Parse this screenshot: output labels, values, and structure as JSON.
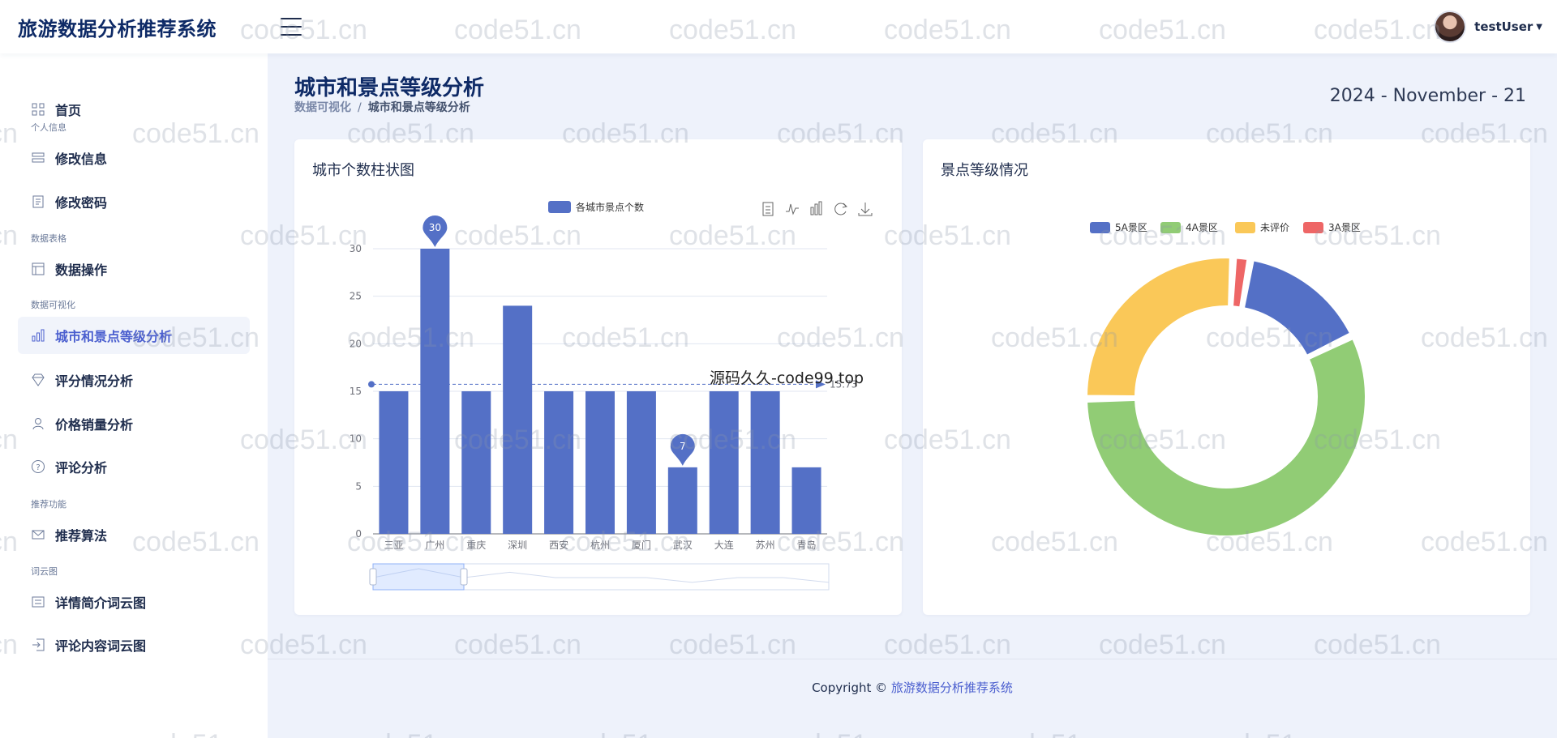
{
  "app": {
    "title": "旅游数据分析推荐系统"
  },
  "user": {
    "name": "testUser"
  },
  "sidebar": {
    "items": [
      {
        "label": "首页",
        "icon": "grid-icon"
      },
      {
        "label": "修改信息",
        "icon": "edit-info-icon"
      },
      {
        "label": "修改密码",
        "icon": "password-icon"
      },
      {
        "label": "数据操作",
        "icon": "table-icon"
      },
      {
        "label": "城市和景点等级分析",
        "icon": "bar-chart-icon",
        "active": true
      },
      {
        "label": "评分情况分析",
        "icon": "diamond-icon"
      },
      {
        "label": "价格销量分析",
        "icon": "user-icon"
      },
      {
        "label": "评论分析",
        "icon": "question-icon"
      },
      {
        "label": "推荐算法",
        "icon": "mail-icon"
      },
      {
        "label": "详情简介词云图",
        "icon": "list-icon"
      },
      {
        "label": "评论内容词云图",
        "icon": "login-icon"
      }
    ],
    "sections": [
      "个人信息",
      "数据表格",
      "数据可视化",
      "推荐功能",
      "词云图"
    ]
  },
  "page": {
    "title": "城市和景点等级分析",
    "breadcrumb": {
      "parent": "数据可视化",
      "current": "城市和景点等级分析",
      "separator": "/"
    },
    "date": "2024 - November - 21"
  },
  "footer": {
    "prefix": "Copyright ©",
    "brand": "旅游数据分析推荐系统"
  },
  "watermarks": {
    "site": "code51.cn",
    "overlay": "源码久久-code99.top"
  },
  "colors": {
    "accent": "#4b5fcf",
    "bar": "#5470c6",
    "green": "#91cc75",
    "yellow": "#fac858",
    "red": "#ee6666"
  },
  "chart_data": [
    {
      "type": "bar",
      "title": "城市个数柱状图",
      "legend": [
        "各城市景点个数"
      ],
      "categories": [
        "三亚",
        "广州",
        "重庆",
        "深圳",
        "西安",
        "杭州",
        "厦门",
        "武汉",
        "大连",
        "苏州",
        "青岛"
      ],
      "series": [
        {
          "name": "各城市景点个数",
          "values": [
            15,
            30,
            15,
            24,
            15,
            15,
            15,
            7,
            15,
            15,
            7
          ]
        }
      ],
      "ylim": [
        0,
        30
      ],
      "yticks": [
        0,
        5,
        10,
        15,
        20,
        25,
        30
      ],
      "mark_points": [
        {
          "label": "30",
          "category": "广州",
          "value": 30
        },
        {
          "label": "7",
          "category": "武汉",
          "value": 7
        }
      ],
      "mark_line": {
        "label": "15.73",
        "value": 15.73
      },
      "grid": true,
      "legend_position": "top-center",
      "toolbox": [
        "data-view-icon",
        "line-switch-icon",
        "bar-switch-icon",
        "restore-icon",
        "download-icon"
      ]
    },
    {
      "type": "pie",
      "title": "景点等级情况",
      "donut": true,
      "legend": [
        "5A景区",
        "4A景区",
        "未评价",
        "3A景区"
      ],
      "legend_position": "top-center",
      "slices": [
        {
          "name": "5A景区",
          "value": 15
        },
        {
          "name": "4A景区",
          "value": 57
        },
        {
          "name": "未评价",
          "value": 26
        },
        {
          "name": "3A景区",
          "value": 2
        }
      ]
    }
  ]
}
